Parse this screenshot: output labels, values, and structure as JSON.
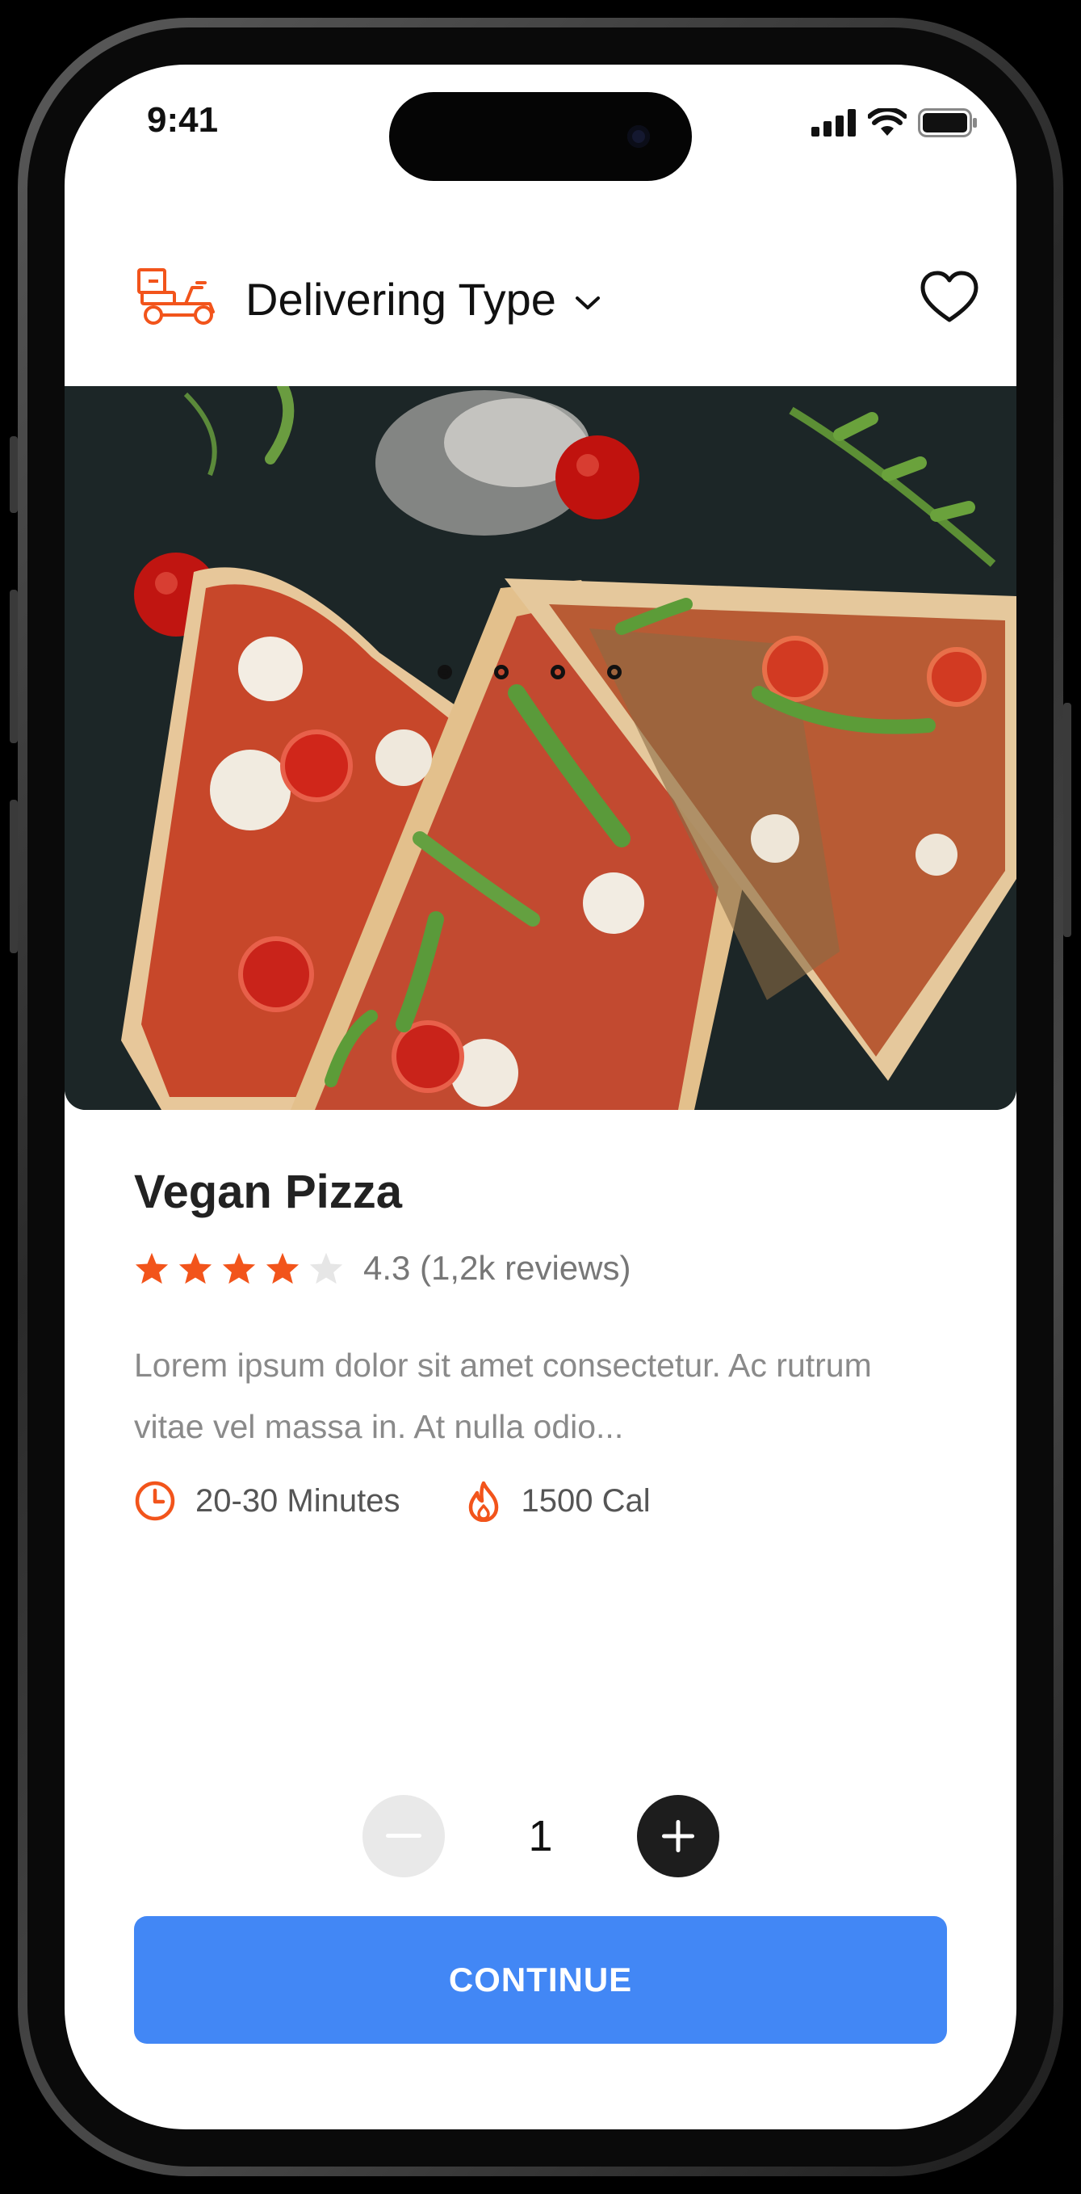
{
  "status_bar": {
    "time": "9:41"
  },
  "header": {
    "title": "Delivering Type"
  },
  "carousel": {
    "dot_count": 4,
    "active_index": 0
  },
  "product": {
    "name": "Vegan Pizza",
    "rating_value": 4.3,
    "rating_text": "4.3 (1,2k reviews)",
    "description": "Lorem ipsum dolor sit amet consectetur. Ac rutrum vitae vel massa in. At nulla odio...",
    "duration": "20-30 Minutes",
    "calories": "1500 Cal"
  },
  "quantity": {
    "value": "1"
  },
  "actions": {
    "continue_label": "CONTINUE"
  },
  "colors": {
    "accent_orange": "#F2541B",
    "button_blue": "#4287F5"
  },
  "icons": [
    "delivery-scooter-icon",
    "chevron-down-icon",
    "heart-icon",
    "star-icon",
    "clock-icon",
    "fire-icon",
    "minus-icon",
    "plus-icon",
    "signal-icon",
    "wifi-icon",
    "battery-icon"
  ]
}
